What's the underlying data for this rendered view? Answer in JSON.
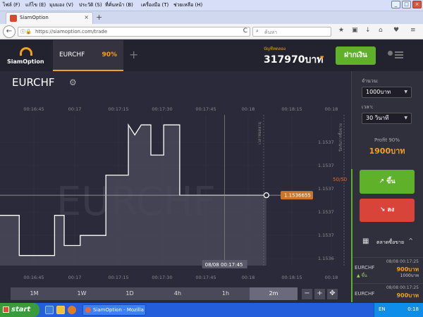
{
  "browser": {
    "menu": [
      "ไฟล์ (F)",
      "แก้ไข (E)",
      "มุมมอง (V)",
      "ประวัติ (S)",
      "ที่คั่นหน้า (B)",
      "เครื่องมือ (T)",
      "ช่วยเหลือ (H)"
    ],
    "window_controls": [
      "_",
      "□",
      "×"
    ],
    "tab_title": "SiamOption",
    "tab_close": "×",
    "newtab": "+",
    "back": "←",
    "url": "https://siamoption.com/trade",
    "reload": "C",
    "search_placeholder": "ค้นหา",
    "toolbar_icons": [
      "★",
      "▣",
      "↓",
      "⌂",
      "♥",
      "≡"
    ]
  },
  "app": {
    "logo_text": "SiamOption",
    "asset_tab": {
      "name": "EURCHF",
      "payout": "90%"
    },
    "add_tab": "+",
    "balance_label": "บัญชีทดลอง",
    "balance_value": "317970บาท",
    "balance_caret": "▼",
    "deposit_label": "ฝากเงิน"
  },
  "chart_header": {
    "symbol": "EURCHF",
    "gear": "⚙"
  },
  "chart_data": {
    "type": "line",
    "symbol_watermark": "EURCHF",
    "x_ticks": [
      "00:16:45",
      "00:17",
      "00:17:15",
      "00:17:30",
      "00:17:45",
      "00:18",
      "00:18:15",
      "00:18"
    ],
    "y_ticks": [
      "1.1537",
      "1.1537",
      "1.1537",
      "1.1537",
      "1.1537",
      "1.1536"
    ],
    "current_price": "1.1536655",
    "crosshair_time": "08/08 00:17:45",
    "payout_marker": "50/50",
    "expiry_label": "เวลาหมดอายุ",
    "close_label": "ปิดรับการซื้อขาย",
    "series": [
      {
        "x": [
          "00:16:35",
          "00:16:41",
          "00:16:41",
          "00:16:52",
          "00:16:52",
          "00:16:55",
          "00:16:55",
          "00:17:00",
          "00:17:00",
          "00:17:08",
          "00:17:08",
          "00:17:15",
          "00:17:15",
          "00:17:17",
          "00:17:19",
          "00:17:22",
          "00:17:22",
          "00:17:26",
          "00:17:26",
          "00:17:28",
          "00:17:28",
          "00:17:31",
          "00:17:31",
          "00:17:58"
        ],
        "y": [
          1.15365,
          1.15365,
          1.15361,
          1.15361,
          1.15365,
          1.15365,
          1.15362,
          1.15362,
          1.15363,
          1.15363,
          1.15369,
          1.15369,
          1.15374,
          1.15373,
          1.15374,
          1.15374,
          1.15371,
          1.15371,
          1.15374,
          1.15374,
          1.15374,
          1.15374,
          1.15367,
          1.15367
        ]
      }
    ],
    "ylim": [
      1.1536,
      1.15375
    ],
    "xlim": [
      "00:16:35",
      "00:18:20"
    ]
  },
  "sidebar": {
    "amount_label": "จำนวน:",
    "amount_value": "1000บาท",
    "time_label": "เวลา:",
    "time_value": "30 วินาที",
    "caret": "▼",
    "profit_label": "Profit 90%",
    "profit_value": "1900บาท",
    "up_label": "↗ ขึ้น",
    "down_label": "↘ ลง",
    "history_icon": "▦",
    "history_title": "ตลาดซื้อขาย",
    "history_caret": "^",
    "history": [
      {
        "time": "08/08 00:17:25",
        "symbol": "EURCHF",
        "amount": "900บาท",
        "direction": "▲ ขึ้น",
        "stake": "1000บาท"
      },
      {
        "time": "08/08 00:17:25",
        "symbol": "EURCHF",
        "amount": "900บาท",
        "direction": "",
        "stake": ""
      }
    ]
  },
  "timeframes": [
    "1M",
    "1W",
    "1D",
    "4h",
    "1h",
    "2m"
  ],
  "active_timeframe": "2m",
  "zoom_buttons": [
    "−",
    "+",
    "✥"
  ],
  "taskbar": {
    "start": "start",
    "task_title": "SiamOption - Mozilla F...",
    "lang": "EN",
    "clock": "0:18"
  }
}
